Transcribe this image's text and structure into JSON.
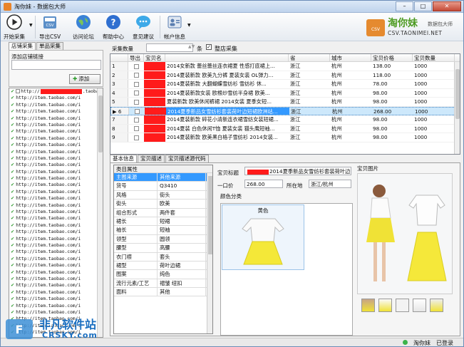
{
  "window": {
    "title": "淘你妹 - 数据包大师",
    "min": "–",
    "max": "□",
    "close": "✕"
  },
  "toolbar": [
    {
      "label": "开始采集",
      "icon": "play-icon",
      "color": "#2b2b2b"
    },
    {
      "label": "导出CSV",
      "icon": "csv-icon",
      "color": "#5b8fc8"
    },
    {
      "label": "访问论坛",
      "icon": "globe-icon",
      "color": "#3a82d6"
    },
    {
      "label": "帮助中心",
      "icon": "help-icon",
      "color": "#2f6fd0"
    },
    {
      "label": "意见建议",
      "icon": "chat-icon",
      "color": "#3da9e8"
    },
    {
      "label": "帐户信息",
      "icon": "account-icon",
      "color": "#5a7db0"
    }
  ],
  "brand": {
    "name": "淘你妹",
    "subtitle": "数据包大师",
    "url": "CSV.TAONIMEI.NET",
    "bag": "CSV"
  },
  "left": {
    "tabs": [
      "店铺采集",
      "单品采集"
    ],
    "group_title": "添加店铺链接",
    "add_label": "添加",
    "first_url": {
      "prefix": "http://",
      "suffix": ".taobao.c"
    },
    "url_prefix": "http://item.taobao.com/i",
    "url_count": 36
  },
  "main": {
    "qty_label": "采集数量",
    "qty_value": "",
    "qty_unit": "条",
    "whole_store_label": "整店采集",
    "columns": [
      "",
      "导出",
      "宝贝名称",
      "",
      "省",
      "城市",
      "宝贝价格",
      "宝贝数量"
    ],
    "rows": [
      {
        "n": "1",
        "title": "2014女新款 蕾丝蕾丝连衣裙夏 性感打底裙上...",
        "prov": "浙江",
        "city": "杭州",
        "price": "138.00",
        "qty": "1000"
      },
      {
        "n": "2",
        "title": "2014夏装新款 欧美九分裤 夏装女装 OL弹力...",
        "prov": "浙江",
        "city": "杭州",
        "price": "118.00",
        "qty": "1000"
      },
      {
        "n": "3",
        "title": "2014夏装新款 大翻蝴蝶雪纺衫 雪纺衫 休...",
        "prov": "浙江",
        "city": "杭州",
        "price": "78.00",
        "qty": "1000"
      },
      {
        "n": "4",
        "title": "2014夏装新款女装 欧根纱雪纺半身裙 欧美...",
        "prov": "浙江",
        "city": "杭州",
        "price": "98.00",
        "qty": "1000"
      },
      {
        "n": "5",
        "title": "夏装新款 欧美休闲裤裙 2014女装 夏季女短...",
        "prov": "浙江",
        "city": "杭州",
        "price": "98.00",
        "qty": "1000"
      },
      {
        "n": "6",
        "title": "2014夏季新品女雪纺衫套装荷叶边短裙欧洲站...",
        "prov": "浙江",
        "city": "杭州",
        "price": "268.00",
        "qty": "1000",
        "selected": true
      },
      {
        "n": "7",
        "title": "2014夏装新款 碎花小清新连衣裙雪纺女装短裙...",
        "prov": "浙江",
        "city": "杭州",
        "price": "98.00",
        "qty": "1000"
      },
      {
        "n": "8",
        "title": "2014夏装 白色休闲T恤 夏装女装 猫头鹰短袖...",
        "prov": "浙江",
        "city": "杭州",
        "price": "98.00",
        "qty": "1000"
      },
      {
        "n": "9",
        "title": "2014夏装新款 欧美黑白格子雪纺衫 2014女装...",
        "prov": "浙江",
        "city": "杭州",
        "price": "98.00",
        "qty": "1000"
      }
    ],
    "detail_tabs": [
      "基本信息",
      "宝贝描述",
      "宝贝描述源代码"
    ],
    "props_title": "类目属性",
    "props_head": [
      "主图来源",
      "其他来源"
    ],
    "props": [
      [
        "货号",
        "Q3410"
      ],
      [
        "风格",
        "街头"
      ],
      [
        "街头",
        "欧美"
      ],
      [
        "组合形式",
        "两件套"
      ],
      [
        "裙长",
        "短裙"
      ],
      [
        "袖长",
        "短袖"
      ],
      [
        "领型",
        "圆领"
      ],
      [
        "腰型",
        "高腰"
      ],
      [
        "衣门襟",
        "套头"
      ],
      [
        "裙型",
        "荷叶边裙"
      ],
      [
        "图案",
        "纯色"
      ],
      [
        "流行元素/工艺",
        "褶皱 纽扣"
      ],
      [
        "面料",
        "其他"
      ]
    ],
    "title_label": "宝贝标题",
    "title_value": "2014夏季新品女雪纺衫套装荷叶边",
    "price_label": "一口价",
    "price_value": "268.00",
    "loc_label": "所在地",
    "loc_value": "浙江/杭州",
    "color_group": "颜色分类",
    "color_swatch": "黄色",
    "image_label": "宝贝图片"
  },
  "status": {
    "user": "淘你妹",
    "state": "已登录"
  },
  "watermark": {
    "cn": "非凡软件站",
    "en": "CRSKY.com"
  }
}
